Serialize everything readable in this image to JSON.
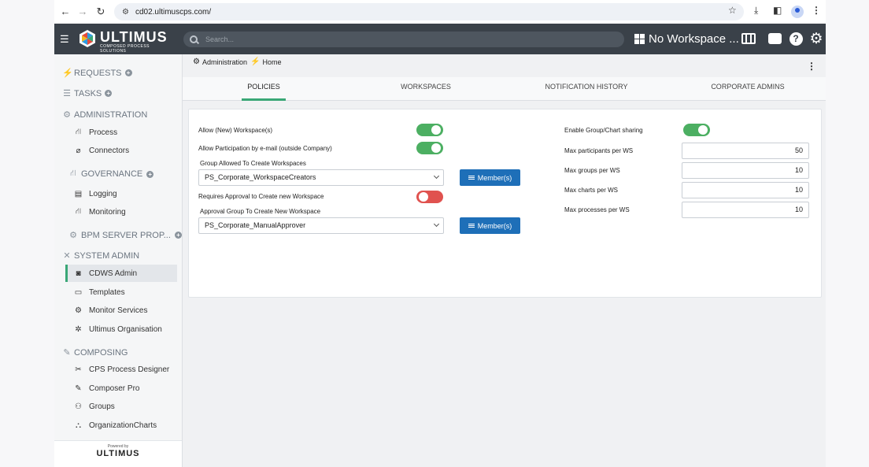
{
  "browser": {
    "url": "cd02.ultimuscps.com/"
  },
  "header": {
    "logo_text": "ULTIMUS",
    "logo_sub": "COMPOSED PROCESS SOLUTIONS",
    "search_placeholder": "Search...",
    "workspace_label": "No Workspace ...",
    "icons": [
      "book-icon",
      "inbox-icon",
      "help-icon",
      "gear-icon"
    ]
  },
  "sidebar": {
    "sections": [
      {
        "label": "REQUESTS",
        "icon": "bolt-icon",
        "has_add": true
      },
      {
        "label": "TASKS",
        "icon": "tasks-icon",
        "has_add": true
      },
      {
        "label": "ADMINISTRATION",
        "icon": "cogs-icon",
        "has_add": false,
        "items": [
          {
            "label": "Process",
            "icon": "process-icon"
          },
          {
            "label": "Connectors",
            "icon": "paperclip-icon"
          }
        ]
      },
      {
        "label": "GOVERNANCE",
        "icon": "governance-icon",
        "has_add": true,
        "items": [
          {
            "label": "Logging",
            "icon": "log-icon"
          },
          {
            "label": "Monitoring",
            "icon": "monitor-icon"
          }
        ]
      },
      {
        "label": "BPM SERVER PROP...",
        "icon": "gear-icon",
        "has_add": true
      },
      {
        "label": "SYSTEM ADMIN",
        "icon": "tools-icon",
        "has_add": false,
        "items": [
          {
            "label": "CDWS Admin",
            "icon": "camera-icon",
            "active": true
          },
          {
            "label": "Templates",
            "icon": "template-icon"
          },
          {
            "label": "Monitor Services",
            "icon": "services-icon"
          },
          {
            "label": "Ultimus Organisation",
            "icon": "org-icon"
          }
        ]
      },
      {
        "label": "COMPOSING",
        "icon": "compose-icon",
        "has_add": false,
        "items": [
          {
            "label": "CPS Process Designer",
            "icon": "designer-icon"
          },
          {
            "label": "Composer Pro",
            "icon": "edit-icon"
          },
          {
            "label": "Groups",
            "icon": "groups-icon"
          },
          {
            "label": "OrganizationCharts",
            "icon": "orgchart-icon"
          }
        ]
      }
    ],
    "powered_by": "Powered by",
    "powered_name": "ULTIMUS"
  },
  "breadcrumb": {
    "first": "Administration",
    "second": "Home"
  },
  "tabs": [
    "POLICIES",
    "WORKSPACES",
    "NOTIFICATION HISTORY",
    "CORPORATE ADMINS"
  ],
  "active_tab": "POLICIES",
  "policies": {
    "allow_new_workspace": {
      "label": "Allow (New) Workspace(s)",
      "state": "on"
    },
    "allow_participation_email": {
      "label": "Allow Participation by e-mail (outside Company)",
      "state": "on"
    },
    "group_allowed_label": "Group Allowed To Create Workspaces",
    "group_allowed_value": "PS_Corporate_WorkspaceCreators",
    "requires_approval": {
      "label": "Requires Approval to Create new Workspace",
      "state": "off"
    },
    "approval_group_label": "Approval Group To Create New Workspace",
    "approval_group_value": "PS_Corporate_ManualApprover",
    "members_button": "Member(s)",
    "enable_sharing": {
      "label": "Enable Group/Chart sharing",
      "state": "on"
    },
    "max_participants": {
      "label": "Max participants per WS",
      "value": "50"
    },
    "max_groups": {
      "label": "Max groups per WS",
      "value": "10"
    },
    "max_charts": {
      "label": "Max charts per WS",
      "value": "10"
    },
    "max_processes": {
      "label": "Max processes per WS",
      "value": "10"
    }
  },
  "colors": {
    "accent_green": "#4caf62",
    "toggle_off": "#e0524f",
    "button_blue": "#1e6fb8",
    "header_bg": "#3a4149",
    "tab_underline": "#3aa776"
  }
}
